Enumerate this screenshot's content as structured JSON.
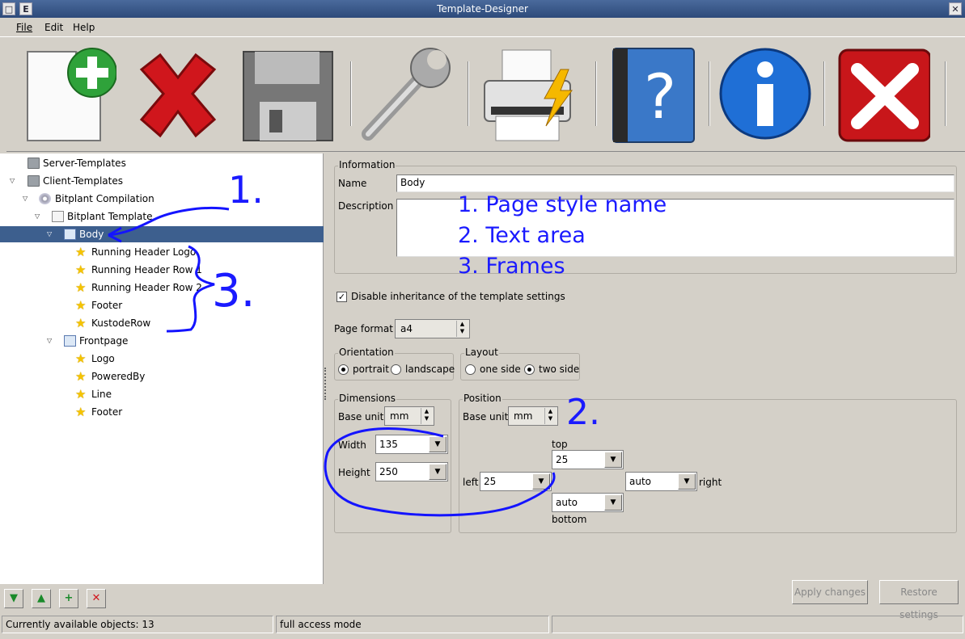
{
  "window": {
    "title": "Template-Designer",
    "sys_label": "E"
  },
  "menu": {
    "file": "File",
    "edit": "Edit",
    "help": "Help"
  },
  "toolbar_icons": [
    "new-template-icon",
    "delete-icon",
    "save-icon",
    "settings-wrench-icon",
    "print-icon",
    "help-book-icon",
    "info-icon",
    "close-icon"
  ],
  "tree": {
    "server_templates": "Server-Templates",
    "client_templates": "Client-Templates",
    "bitplant_compilation": "Bitplant Compilation",
    "bitplant_template": "Bitplant Template",
    "body": "Body",
    "running_header_logo": "Running Header Logo",
    "running_header_row1": "Running Header Row 1",
    "running_header_row2": "Running Header Row 2",
    "footer": "Footer",
    "kustoderow": "KustodeRow",
    "frontpage": "Frontpage",
    "logo": "Logo",
    "poweredby": "PoweredBy",
    "line": "Line",
    "footer2": "Footer"
  },
  "annotations": {
    "note1": "1. Page style name",
    "note2": "2. Text area",
    "note3": "3. Frames",
    "mark1": "1.",
    "mark2": "2.",
    "mark3": "3."
  },
  "information": {
    "group": "Information",
    "name_label": "Name",
    "name_value": "Body",
    "description_label": "Description"
  },
  "inherit": {
    "label": "Disable inheritance of the template settings",
    "checked": true
  },
  "page_format": {
    "label": "Page format",
    "value": "a4"
  },
  "orientation": {
    "group": "Orientation",
    "portrait": "portrait",
    "landscape": "landscape",
    "selected": "portrait"
  },
  "layout": {
    "group": "Layout",
    "one_side": "one side",
    "two_side": "two side",
    "selected": "two side"
  },
  "dimensions": {
    "group": "Dimensions",
    "base_unit_label": "Base unit",
    "base_unit": "mm",
    "width_label": "Width",
    "width": "135",
    "height_label": "Height",
    "height": "250"
  },
  "position": {
    "group": "Position",
    "base_unit_label": "Base unit",
    "base_unit": "mm",
    "top_label": "top",
    "top": "25",
    "left_label": "left",
    "left": "25",
    "right_label": "right",
    "right": "auto",
    "bottom_label": "bottom",
    "bottom": "auto"
  },
  "buttons": {
    "apply": "Apply changes",
    "restore": "Restore settings"
  },
  "status": {
    "objects": "Currently available objects: 13",
    "mode": "full access mode"
  }
}
